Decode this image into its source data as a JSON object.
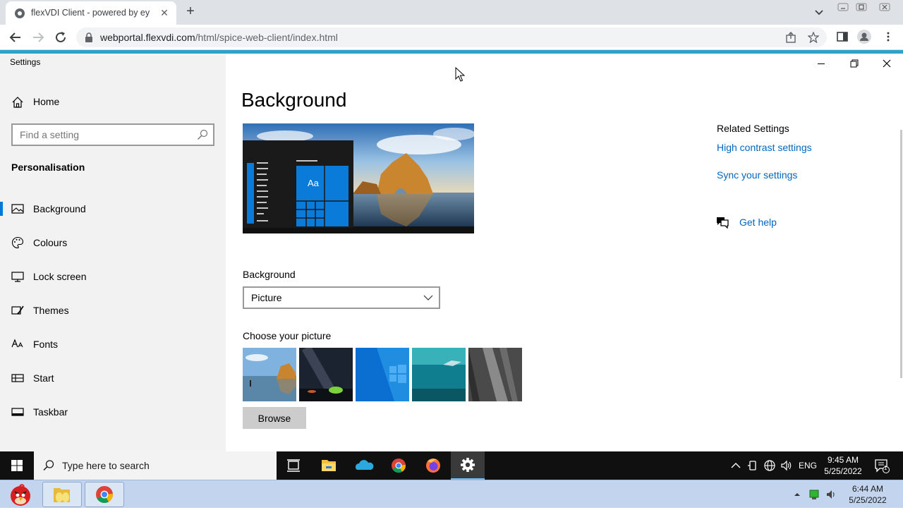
{
  "browser": {
    "tab_title": "flexVDI Client - powered by ey",
    "tab_close": "✕",
    "new_tab": "+",
    "url_host": "webportal.flexvdi.com",
    "url_path": "/html/spice-web-client/index.html"
  },
  "settings_window": {
    "title": "Settings"
  },
  "sidebar": {
    "home_label": "Home",
    "search_placeholder": "Find a setting",
    "section_title": "Personalisation",
    "items": [
      {
        "label": "Background",
        "icon": "picture-icon",
        "active": true
      },
      {
        "label": "Colours",
        "icon": "palette-icon",
        "active": false
      },
      {
        "label": "Lock screen",
        "icon": "monitor-icon",
        "active": false
      },
      {
        "label": "Themes",
        "icon": "brush-icon",
        "active": false
      },
      {
        "label": "Fonts",
        "icon": "font-icon",
        "active": false
      },
      {
        "label": "Start",
        "icon": "start-grid-icon",
        "active": false
      },
      {
        "label": "Taskbar",
        "icon": "taskbar-icon",
        "active": false
      }
    ]
  },
  "main": {
    "page_title": "Background",
    "preview_tile_text": "Aa",
    "background_label": "Background",
    "background_value": "Picture",
    "choose_label": "Choose your picture",
    "browse_label": "Browse"
  },
  "related": {
    "title": "Related Settings",
    "links": [
      "High contrast settings",
      "Sync your settings"
    ],
    "get_help": "Get help"
  },
  "taskbar": {
    "search_placeholder": "Type here to search",
    "lang": "ENG",
    "time": "9:45 AM",
    "date": "5/25/2022",
    "notification_count": "1"
  },
  "host_taskbar": {
    "time": "6:44 AM",
    "date": "5/25/2022"
  },
  "colors": {
    "accent": "#0078d7",
    "link": "#0067c0",
    "spice_bar": "#2ea3c9"
  }
}
